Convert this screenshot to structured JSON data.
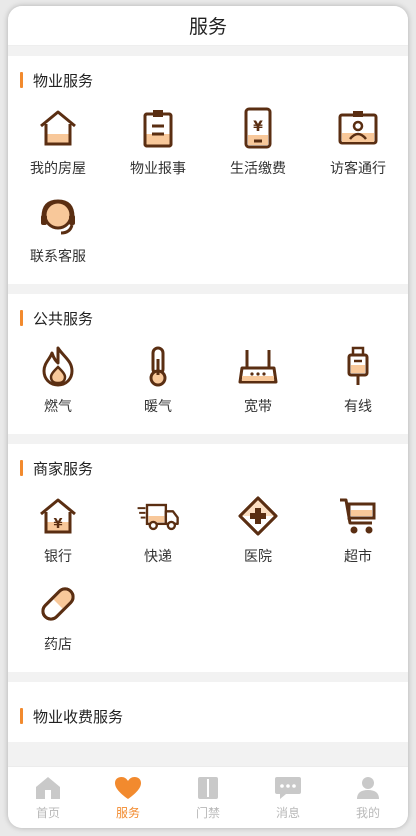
{
  "header": {
    "title": "服务"
  },
  "colors": {
    "accent": "#f28a2e",
    "icon_stroke": "#5a2e12",
    "tab_inactive": "#b9b9b9"
  },
  "sections": [
    {
      "title": "物业服务",
      "items": [
        {
          "label": "我的房屋",
          "icon": "house-icon"
        },
        {
          "label": "物业报事",
          "icon": "clipboard-icon"
        },
        {
          "label": "生活缴费",
          "icon": "payment-phone-icon"
        },
        {
          "label": "访客通行",
          "icon": "visitor-badge-icon"
        },
        {
          "label": "联系客服",
          "icon": "headset-icon"
        }
      ]
    },
    {
      "title": "公共服务",
      "items": [
        {
          "label": "燃气",
          "icon": "flame-icon"
        },
        {
          "label": "暖气",
          "icon": "thermometer-icon"
        },
        {
          "label": "宽带",
          "icon": "router-icon"
        },
        {
          "label": "有线",
          "icon": "cable-plug-icon"
        }
      ]
    },
    {
      "title": "商家服务",
      "items": [
        {
          "label": "银行",
          "icon": "bank-icon"
        },
        {
          "label": "快递",
          "icon": "truck-icon"
        },
        {
          "label": "医院",
          "icon": "hospital-cross-icon"
        },
        {
          "label": "超市",
          "icon": "cart-icon"
        },
        {
          "label": "药店",
          "icon": "pill-icon"
        }
      ]
    },
    {
      "title": "物业收费服务",
      "items": []
    }
  ],
  "tabbar": [
    {
      "label": "首页",
      "icon": "home-icon",
      "active": false
    },
    {
      "label": "服务",
      "icon": "heart-icon",
      "active": true
    },
    {
      "label": "门禁",
      "icon": "door-icon",
      "active": false
    },
    {
      "label": "消息",
      "icon": "chat-icon",
      "active": false
    },
    {
      "label": "我的",
      "icon": "person-icon",
      "active": false
    }
  ]
}
